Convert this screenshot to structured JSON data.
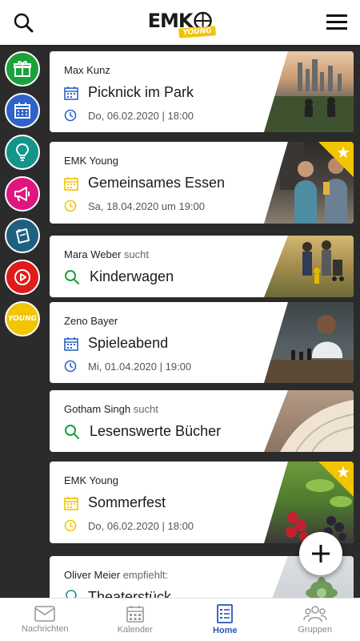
{
  "header": {
    "logo_main": "EMK",
    "logo_young": "YOUNG",
    "search_icon": "search-icon",
    "menu_icon": "hamburger-menu-icon"
  },
  "sidebar": {
    "items": [
      {
        "name": "gift",
        "color": "#1aa23a"
      },
      {
        "name": "calendar",
        "color": "#2e63c9"
      },
      {
        "name": "lightbulb",
        "color": "#14958b"
      },
      {
        "name": "megaphone",
        "color": "#e0157f"
      },
      {
        "name": "note",
        "color": "#1d6080"
      },
      {
        "name": "play",
        "color": "#e01b1b"
      },
      {
        "name": "young",
        "label": "YOUNG",
        "color": "#f2c500"
      }
    ]
  },
  "cards": [
    {
      "author": "Max Kunz",
      "verb": "",
      "title": "Picknick im Park",
      "date": "Do, 06.02.2020 | 18:00",
      "type": "event",
      "color": "#2e63c9",
      "featured": false
    },
    {
      "author": "EMK Young",
      "verb": "",
      "title": "Gemeinsames Essen",
      "date": "Sa, 18.04.2020 um 19:00",
      "type": "event",
      "color": "#f2c500",
      "featured": true
    },
    {
      "author": "Mara Weber",
      "verb": "sucht",
      "title": "Kinderwagen",
      "date": "",
      "type": "search",
      "color": "#1aa23a",
      "featured": false
    },
    {
      "author": "Zeno Bayer",
      "verb": "",
      "title": "Spieleabend",
      "date": "Mi, 01.04.2020 | 19:00",
      "type": "event",
      "color": "#2e63c9",
      "featured": false
    },
    {
      "author": "Gotham Singh",
      "verb": "sucht",
      "title": "Lesenswerte Bücher",
      "date": "",
      "type": "search",
      "color": "#1aa23a",
      "featured": false
    },
    {
      "author": "EMK Young",
      "verb": "",
      "title": "Sommerfest",
      "date": "Do, 06.02.2020 | 18:00",
      "type": "event",
      "color": "#f2c500",
      "featured": true
    },
    {
      "author": "Oliver Meier",
      "verb": "empfiehlt:",
      "title": "Theaterstück",
      "date": "",
      "type": "recommend",
      "color": "#14958b",
      "featured": false
    }
  ],
  "fab": {
    "icon": "plus-icon"
  },
  "bottom_nav": {
    "items": [
      {
        "label": "Nachrichten",
        "icon": "mail-icon",
        "active": false
      },
      {
        "label": "Kalender",
        "icon": "calendar-icon",
        "active": false
      },
      {
        "label": "Home",
        "icon": "home-list-icon",
        "active": true
      },
      {
        "label": "Gruppen",
        "icon": "group-icon",
        "active": false
      }
    ]
  }
}
